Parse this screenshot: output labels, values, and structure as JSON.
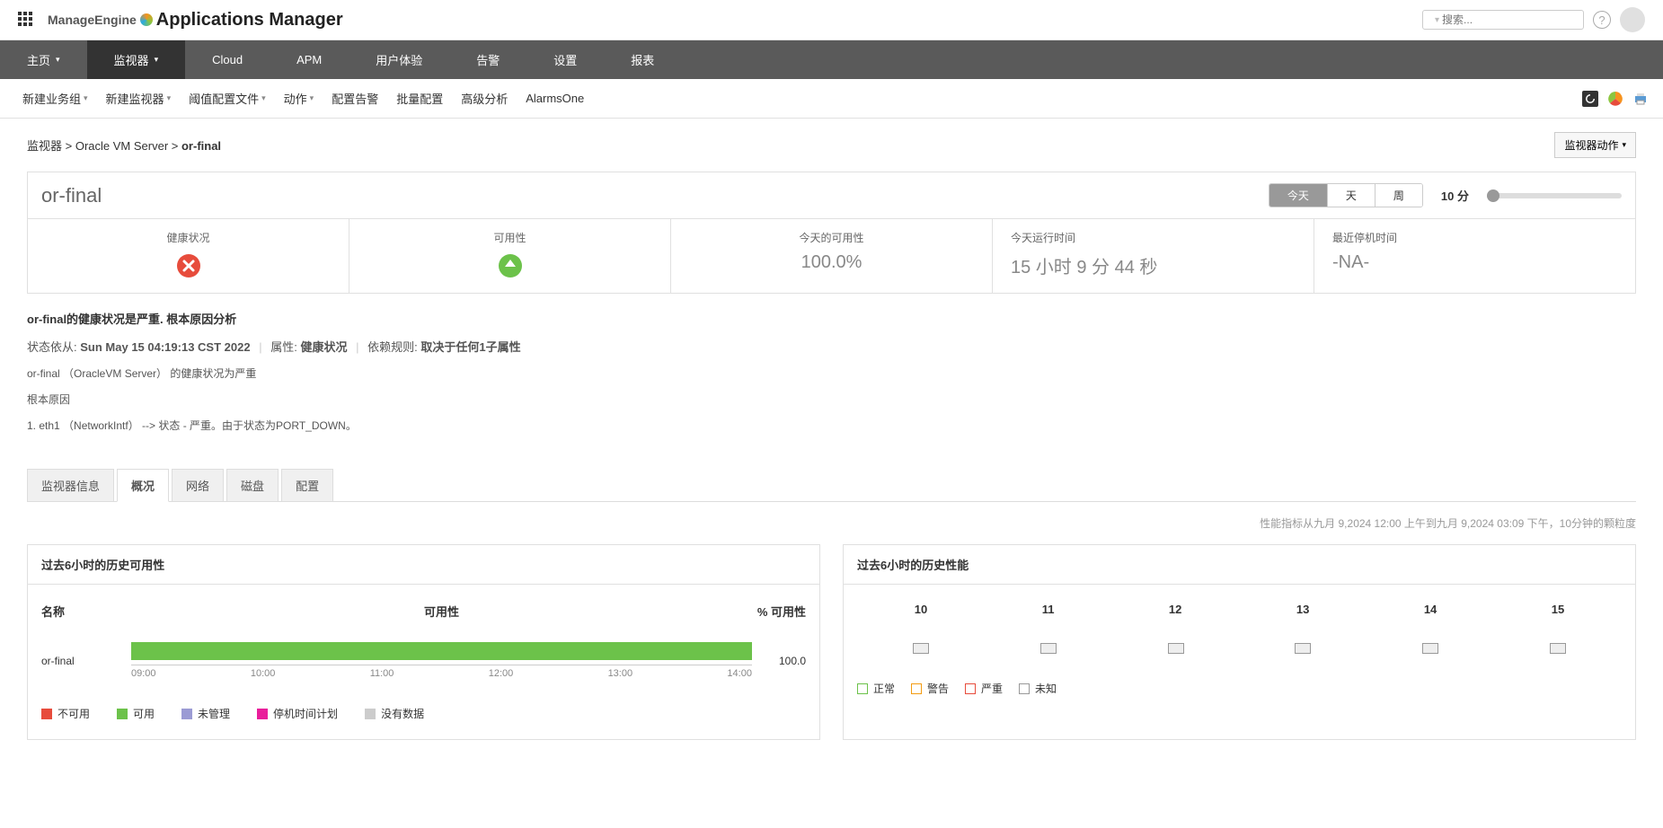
{
  "top": {
    "logo1": "ManageEngine",
    "logo2": "Applications Manager",
    "searchPlaceholder": "搜索..."
  },
  "nav": {
    "items": [
      "主页",
      "监视器",
      "Cloud",
      "APM",
      "用户体验",
      "告警",
      "设置",
      "报表"
    ],
    "activeIndex": 1
  },
  "subnav": {
    "items": [
      "新建业务组",
      "新建监视器",
      "阈值配置文件",
      "动作",
      "配置告警",
      "批量配置",
      "高级分析",
      "AlarmsOne"
    ],
    "hasDropdown": [
      true,
      true,
      true,
      true,
      false,
      false,
      false,
      false
    ]
  },
  "breadcrumb": {
    "l1": "监视器",
    "l2": "Oracle VM Server",
    "l3": "or-final"
  },
  "actionBtn": "监视器动作",
  "pageTitle": "or-final",
  "timeTabs": {
    "items": [
      "今天",
      "天",
      "周"
    ],
    "active": 0,
    "label": "10 分"
  },
  "stats": {
    "health": {
      "label": "健康状况"
    },
    "avail": {
      "label": "可用性"
    },
    "todayAvail": {
      "label": "今天的可用性",
      "value": "100.0%"
    },
    "uptime": {
      "label": "今天运行时间",
      "value": "15 小时 9 分 44 秒"
    },
    "lastDown": {
      "label": "最近停机时间",
      "value": "-NA-"
    }
  },
  "health": {
    "title": "or-final的健康状况是严重. 根本原因分析",
    "statusSinceLabel": "状态依从:",
    "statusSince": "Sun May 15 04:19:13 CST 2022",
    "attrLabel": "属性:",
    "attr": "健康状况",
    "ruleLabel": "依赖规则:",
    "rule": "取决于任何1子属性",
    "line1": "or-final （OracleVM Server） 的健康状况为严重",
    "rootCauseLabel": "根本原因",
    "cause1": "1. eth1 （NetworkIntf） --> 状态 - 严重。由于状态为PORT_DOWN。"
  },
  "tabs": {
    "items": [
      "监视器信息",
      "概况",
      "网络",
      "磁盘",
      "配置"
    ],
    "active": 1
  },
  "perfNote": "性能指标从九月 9,2024 12:00 上午到九月 9,2024 03:09 下午，10分钟的颗粒度",
  "panel1": {
    "title": "过去6小时的历史可用性",
    "colName": "名称",
    "colAvail": "可用性",
    "colPct": "% 可用性",
    "rowName": "or-final",
    "rowPct": "100.0",
    "ticks": [
      "09:00",
      "10:00",
      "11:00",
      "12:00",
      "13:00",
      "14:00"
    ],
    "legend": [
      "不可用",
      "可用",
      "未管理",
      "停机时间计划",
      "没有数据"
    ]
  },
  "panel2": {
    "title": "过去6小时的历史性能",
    "hours": [
      "10",
      "11",
      "12",
      "13",
      "14",
      "15"
    ],
    "legend": [
      "正常",
      "警告",
      "严重",
      "未知"
    ]
  },
  "chart_data": {
    "type": "bar",
    "categories": [
      "or-final"
    ],
    "values": [
      100.0
    ],
    "title": "过去6小时的历史可用性",
    "xlabel": "",
    "ylabel": "% 可用性",
    "ylim": [
      0,
      100
    ]
  }
}
